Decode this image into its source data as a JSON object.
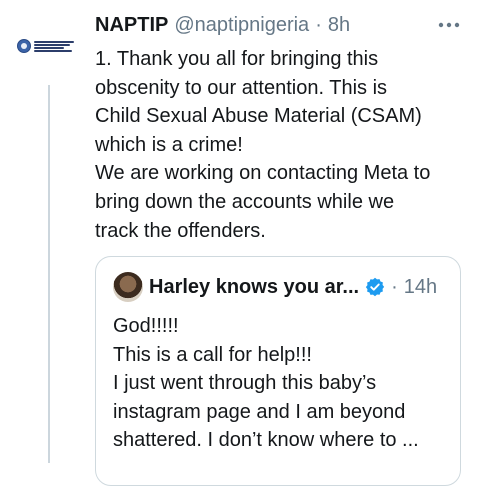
{
  "tweet": {
    "display_name": "NAPTIP",
    "handle": "@naptipnigeria",
    "separator": "·",
    "time": "8h",
    "lines": [
      "1. Thank you all for bringing this",
      "obscenity to our attention. This is",
      "Child Sexual Abuse Material (CSAM)",
      "which is a crime!",
      "We are working on contacting Meta to",
      "bring down the accounts while we",
      "track the offenders."
    ],
    "more_icon": "more-horizontal-icon",
    "avatar_icon": "organization-logo"
  },
  "quote": {
    "display_name": "Harley knows you ar...",
    "separator": "·",
    "time": "14h",
    "verified_icon": "verified-badge-icon",
    "lines": [
      "God!!!!!",
      "This is a call for help!!!",
      "I just went through this baby’s",
      "instagram page and I am beyond",
      "shattered. I don’t know where to ..."
    ]
  },
  "colors": {
    "text": "#14171a",
    "secondary": "#657786",
    "border": "#cfd9de",
    "thread_line": "#ccd6dd",
    "verified": "#1d9bf0"
  }
}
